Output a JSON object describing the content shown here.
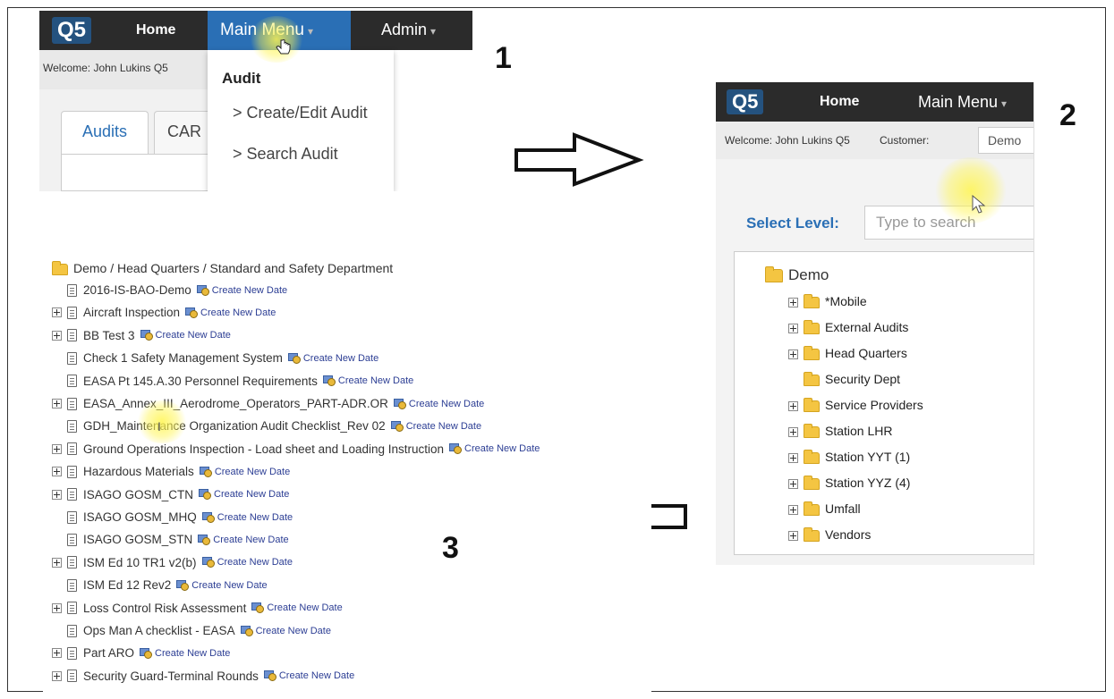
{
  "step_labels": [
    "1",
    "2",
    "3"
  ],
  "panel1": {
    "logo": "Q5",
    "nav_home": "Home",
    "nav_main_menu": "Main Menu",
    "nav_admin": "Admin",
    "welcome": "Welcome: John Lukins Q5",
    "tabs": [
      "Audits",
      "CAR"
    ],
    "dropdown": {
      "header": "Audit",
      "items": [
        "> Create/Edit Audit",
        "> Search Audit"
      ]
    }
  },
  "panel2": {
    "logo": "Q5",
    "nav_home": "Home",
    "nav_main_menu": "Main Menu",
    "welcome": "Welcome: John Lukins Q5",
    "customer_label": "Customer:",
    "customer_value": "Demo",
    "select_level_label": "Select Level:",
    "search_placeholder": "Type to search",
    "tree_root": "Demo",
    "tree_items": [
      {
        "label": "*Mobile",
        "expandable": true
      },
      {
        "label": "External Audits",
        "expandable": true
      },
      {
        "label": "Head Quarters",
        "expandable": true
      },
      {
        "label": "Security Dept",
        "expandable": false
      },
      {
        "label": "Service Providers",
        "expandable": true
      },
      {
        "label": "Station LHR",
        "expandable": true
      },
      {
        "label": "Station YYT (1)",
        "expandable": true
      },
      {
        "label": "Station YYZ (4)",
        "expandable": true
      },
      {
        "label": "Umfall",
        "expandable": true
      },
      {
        "label": "Vendors",
        "expandable": true
      }
    ]
  },
  "panel3": {
    "breadcrumb": "Demo / Head Quarters / Standard and Safety Department",
    "create_link": "Create New Date",
    "items": [
      {
        "label": "2016-IS-BAO-Demo",
        "expandable": false
      },
      {
        "label": "Aircraft Inspection",
        "expandable": true
      },
      {
        "label": "BB Test 3",
        "expandable": true
      },
      {
        "label": "Check 1 Safety Management System",
        "expandable": false
      },
      {
        "label": "EASA Pt 145.A.30 Personnel Requirements",
        "expandable": false
      },
      {
        "label": "EASA_Annex_III_Aerodrome_Operators_PART-ADR.OR",
        "expandable": true
      },
      {
        "label": "GDH_Maintenance Organization Audit Checklist_Rev 02",
        "expandable": false
      },
      {
        "label": "Ground Operations Inspection - Load sheet and Loading Instruction",
        "expandable": true
      },
      {
        "label": "Hazardous Materials",
        "expandable": true
      },
      {
        "label": "ISAGO GOSM_CTN",
        "expandable": true
      },
      {
        "label": "ISAGO GOSM_MHQ",
        "expandable": false
      },
      {
        "label": "ISAGO GOSM_STN",
        "expandable": false
      },
      {
        "label": "ISM Ed 10 TR1 v2(b)",
        "expandable": true
      },
      {
        "label": "ISM Ed 12 Rev2",
        "expandable": false
      },
      {
        "label": "Loss Control Risk Assessment",
        "expandable": true
      },
      {
        "label": "Ops Man A checklist - EASA",
        "expandable": false
      },
      {
        "label": "Part ARO",
        "expandable": true
      },
      {
        "label": "Security Guard-Terminal Rounds",
        "expandable": true
      }
    ]
  },
  "colors": {
    "navbar": "#2b2b2b",
    "active_menu": "#2a6fb5",
    "accent_blue": "#2a6fb5",
    "link": "#2c3e94",
    "folder": "#f4c542",
    "highlight": "#fff550"
  }
}
